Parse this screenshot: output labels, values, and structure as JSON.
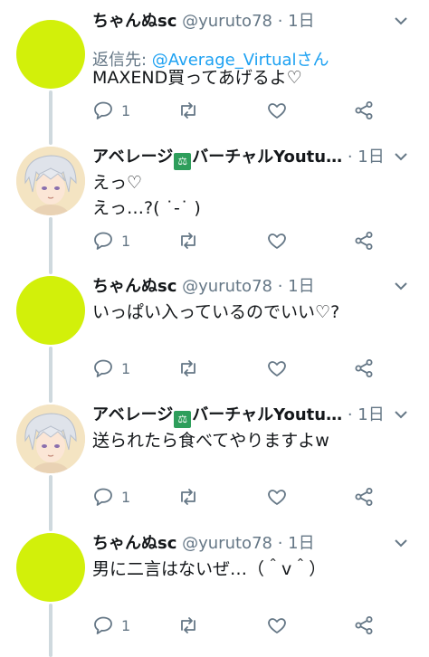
{
  "colors": {
    "accent": "#1da1f2",
    "muted": "#657786",
    "lime_avatar": "#d2f00a",
    "thread_line": "#cfd9de"
  },
  "tweets": [
    {
      "name": "ちゃんぬsc",
      "handle": "@yuruto78",
      "sep": "·",
      "time": "1日",
      "reply_prefix": "返信先: ",
      "reply_mention": "@Average_Virtualさん",
      "lines": [
        "MAXEND買ってあげるよ♡"
      ],
      "reply_count": "1",
      "avatar": "lime-circle"
    },
    {
      "name_a": "アベレージ",
      "badge": "⚖",
      "name_b": "バーチャルYoutu…",
      "sep": "·",
      "time": "1日",
      "lines": [
        "えっ♡",
        "えっ…?( ˙-˙ )"
      ],
      "reply_count": "1",
      "avatar": "anime-character"
    },
    {
      "name": "ちゃんぬsc",
      "handle": "@yuruto78",
      "sep": "·",
      "time": "1日",
      "lines": [
        "いっぱい入っているのでいい♡?"
      ],
      "reply_count": "1",
      "avatar": "lime-circle"
    },
    {
      "name_a": "アベレージ",
      "badge": "⚖",
      "name_b": "バーチャルYoutu…",
      "sep": "·",
      "time": "1日",
      "lines": [
        "送られたら食べてやりますよw"
      ],
      "reply_count": "1",
      "avatar": "anime-character"
    },
    {
      "name": "ちゃんぬsc",
      "handle": "@yuruto78",
      "sep": "·",
      "time": "1日",
      "lines": [
        "男に二言はないぜ…（＾v＾）"
      ],
      "reply_count": "1",
      "avatar": "lime-circle"
    }
  ]
}
